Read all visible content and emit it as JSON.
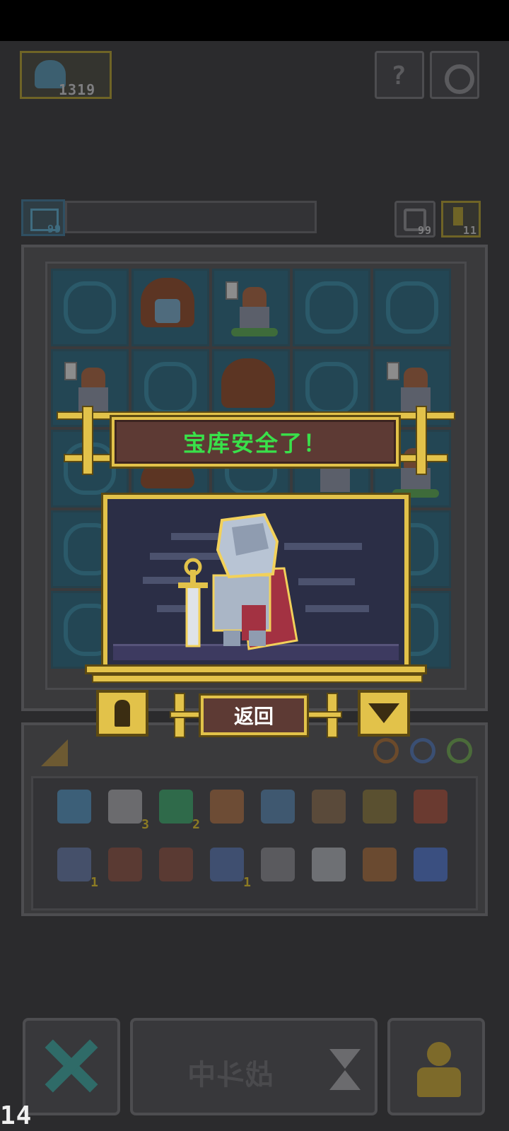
{
  "header": {
    "coins": "1319",
    "help_icon": "question-icon",
    "settings_icon": "gear-icon"
  },
  "board_bar": {
    "left_count": "99",
    "right_a_count": "99",
    "right_b_count": "11"
  },
  "dialog": {
    "banner_text": "宝库安全了！",
    "return_label": "返回",
    "left_icon": "pawn-icon",
    "right_icon": "heart-gem-icon"
  },
  "inventory": {
    "items": [
      {
        "icon": "blue-pouch-icon",
        "qty": ""
      },
      {
        "icon": "scroll-icon",
        "qty": "3"
      },
      {
        "icon": "green-gem-icon",
        "qty": "2"
      },
      {
        "icon": "coral-icon",
        "qty": ""
      },
      {
        "icon": "blue-rock-icon",
        "qty": ""
      },
      {
        "icon": "hammer-icon",
        "qty": ""
      },
      {
        "icon": "painting-icon",
        "qty": ""
      },
      {
        "icon": "backpack-icon",
        "qty": ""
      },
      {
        "icon": "stairs-icon",
        "qty": "1"
      },
      {
        "icon": "fence-icon",
        "qty": ""
      },
      {
        "icon": "crate-icon",
        "qty": ""
      },
      {
        "icon": "crystal-icon",
        "qty": "1"
      },
      {
        "icon": "boot-icon",
        "qty": ""
      },
      {
        "icon": "spikes-icon",
        "qty": ""
      },
      {
        "icon": "wooden-stick-icon",
        "qty": ""
      },
      {
        "icon": "blue-potion-icon",
        "qty": ""
      }
    ]
  },
  "bottom": {
    "battle_label": "战斗中",
    "fps": "14"
  },
  "colors": {
    "gold": "#e2c24a",
    "banner_bg": "#5d3a34",
    "banner_text": "#39e14a",
    "background": "#2b2b2d"
  }
}
